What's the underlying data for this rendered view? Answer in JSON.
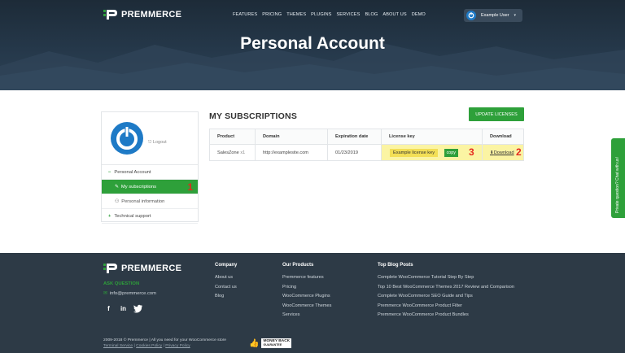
{
  "brand": {
    "name": "PREMMERCE"
  },
  "nav": [
    "FEATURES",
    "PRICING",
    "THEMES",
    "PLUGINS",
    "SERVICES",
    "BLOG",
    "ABOUT US",
    "DEMO"
  ],
  "user": {
    "name": "Example User"
  },
  "hero": {
    "title": "Personal Account"
  },
  "sidebar": {
    "logout": "Logout",
    "items": [
      {
        "label": "Personal Account",
        "prefix": "−"
      },
      {
        "label": "My subscriptions",
        "annotation": "1"
      },
      {
        "label": "Personal information"
      },
      {
        "label": "Technical support",
        "prefix": "+"
      }
    ]
  },
  "main": {
    "title": "MY SUBSCRIPTIONS",
    "update_button": "UPDATE LICENSES",
    "columns": [
      "Product",
      "Domain",
      "Expiration date",
      "License key",
      "Download"
    ],
    "rows": [
      {
        "product": "SalesZone",
        "qty": "x1",
        "domain": "http://examplesite.com",
        "expiration": "01/23/2019",
        "license": "Example license key",
        "copy": "copy",
        "license_annotation": "3",
        "download": "Download",
        "download_annotation": "2"
      }
    ]
  },
  "feedback_tab": "Private question? Chat with us!",
  "footer": {
    "ask": "ASK QUESTION",
    "email": "info@premmerce.com",
    "company": {
      "title": "Company",
      "items": [
        "About us",
        "Contact us",
        "Blog"
      ]
    },
    "products": {
      "title": "Our Products",
      "items": [
        "Premmerce features",
        "Pricing",
        "WooCommerce Plugins",
        "WooCommerce Themes",
        "Services"
      ]
    },
    "blog": {
      "title": "Top Blog Posts",
      "items": [
        "Complete WooCommerce Tutorial Step By Step",
        "Top 10 Best WooCommerce Themes 2017 Review and Comparison",
        "Complete WooCommerce SEO Guide and Tips",
        "Premmerce WooCommerce Product Filter",
        "Premmerce WooCommerce Product Bundles"
      ]
    },
    "copyright": "2009-2018 © Premmerce | All you need for your WooCommerce store",
    "terms": [
      "Terminal Service",
      "Cookies Policy",
      "Privacy Policy"
    ],
    "money_back": [
      "MONEY BACK",
      "GUARANTEE"
    ]
  },
  "colors": {
    "accent": "#2ea03a",
    "hero_bg": "#25384a",
    "footer_bg": "#2d3a46",
    "highlight": "#fbf4a3",
    "annotation": "#e5281e"
  }
}
